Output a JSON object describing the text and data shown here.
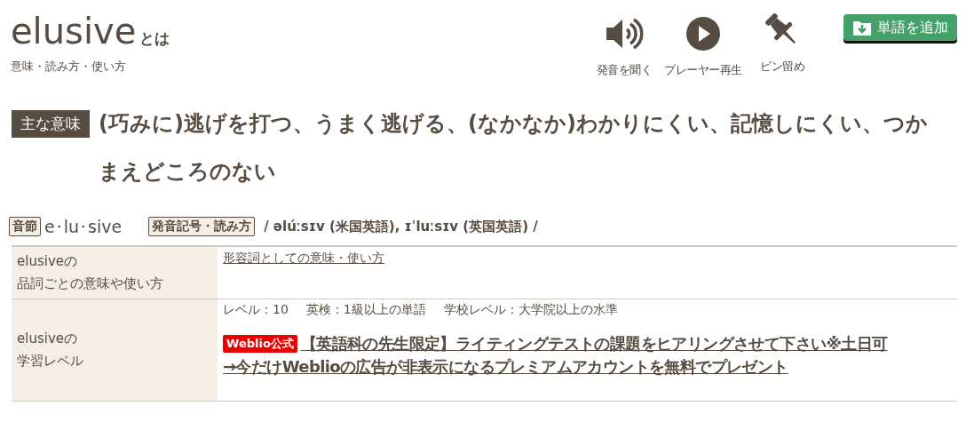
{
  "header": {
    "word": "elusive",
    "suffix": "とは",
    "subtitle": "意味・読み方・使い方"
  },
  "actions": [
    {
      "kind": "speaker",
      "label": "発音を聞く"
    },
    {
      "kind": "play",
      "label": "プレーヤー再生"
    },
    {
      "kind": "pin",
      "label": "ピン留め"
    }
  ],
  "add_button": {
    "label": "単語を追加"
  },
  "main_meaning": {
    "badge": "主な意味",
    "text": "(巧みに)逃げを打つ、うまく逃げる、(なかなか)わかりにくい、記憶しにくい、つかまえどころのない"
  },
  "syllables": {
    "badge": "音節",
    "text": "e･lu･sive"
  },
  "pronunciation": {
    "badge": "発音記号・読み方",
    "text": "/ əlúːsɪv (米国英語), ɪˈluːsɪv (英国英語) /"
  },
  "table": {
    "rows": [
      {
        "kind": "pos",
        "header_lines": [
          "elusiveの",
          "品詞ごとの意味や使い方"
        ],
        "link": "形容詞としての意味・使い方"
      },
      {
        "kind": "level",
        "header_lines": [
          "elusiveの",
          "学習レベル"
        ],
        "levels": [
          "レベル：10",
          "英検：1級以上の単語",
          "学校レベル：大学院以上の水準"
        ],
        "ad_badge": "Weblio公式",
        "ad_lines": [
          "【英語科の先生限定】ライティングテストの課題をヒアリングさせて下さい※土日可",
          "→今だけWeblioの広告が非表示になるプレミアムアカウントを無料でプレゼント"
        ]
      }
    ]
  }
}
